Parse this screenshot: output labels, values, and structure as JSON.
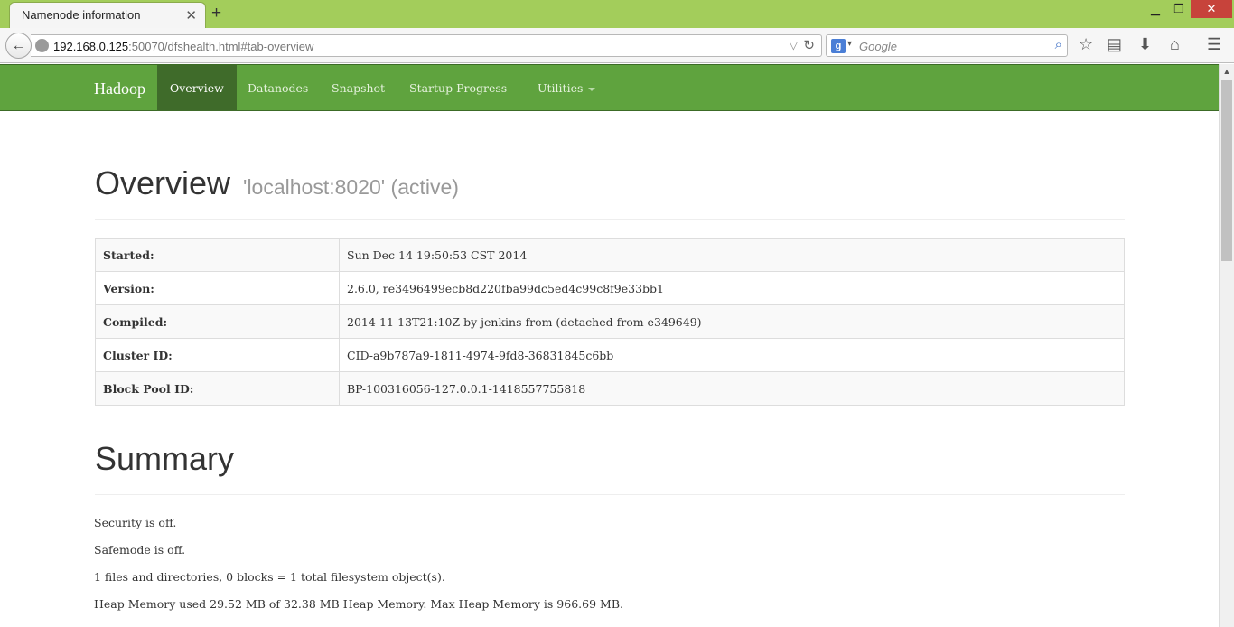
{
  "browser": {
    "tab_title": "Namenode information",
    "tab_close": "✕",
    "new_tab": "+",
    "url_host": "192.168.0.125",
    "url_rest": ":50070/dfshealth.html#tab-overview",
    "search_placeholder": "Google",
    "search_engine_letter": "g"
  },
  "nav": {
    "brand": "Hadoop",
    "items": [
      {
        "label": "Overview",
        "active": true
      },
      {
        "label": "Datanodes"
      },
      {
        "label": "Snapshot"
      },
      {
        "label": "Startup Progress"
      },
      {
        "label": "Utilities"
      }
    ]
  },
  "overview": {
    "title": "Overview",
    "subtitle": "'localhost:8020' (active)",
    "rows": [
      {
        "key": "Started:",
        "value": "Sun Dec 14 19:50:53 CST 2014"
      },
      {
        "key": "Version:",
        "value": "2.6.0, re3496499ecb8d220fba99dc5ed4c99c8f9e33bb1"
      },
      {
        "key": "Compiled:",
        "value": "2014-11-13T21:10Z by jenkins from (detached from e349649)"
      },
      {
        "key": "Cluster ID:",
        "value": "CID-a9b787a9-1811-4974-9fd8-36831845c6bb"
      },
      {
        "key": "Block Pool ID:",
        "value": "BP-100316056-127.0.0.1-1418557755818"
      }
    ]
  },
  "summary": {
    "title": "Summary",
    "lines": [
      "Security is off.",
      "Safemode is off.",
      "1 files and directories, 0 blocks = 1 total filesystem object(s).",
      "Heap Memory used 29.52 MB of 32.38 MB Heap Memory. Max Heap Memory is 966.69 MB."
    ]
  },
  "colors": {
    "titlebar": "#a3cd5b",
    "navbar": "#5fa33e",
    "nav_active": "#3f6b2a"
  }
}
